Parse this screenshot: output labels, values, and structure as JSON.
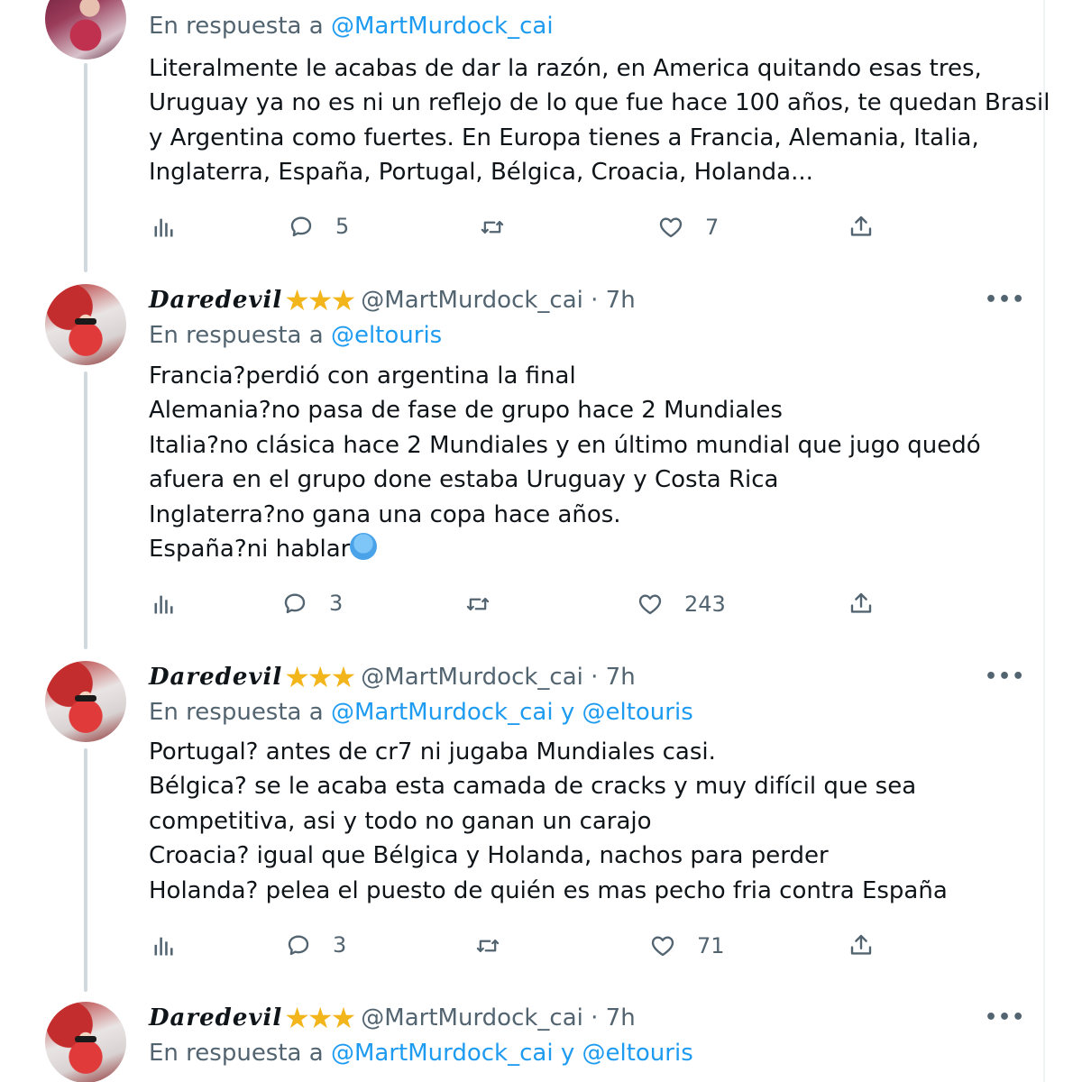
{
  "tweets": [
    {
      "reply_prefix": "En respuesta a ",
      "reply_mentions": "@MartMurdock_cai",
      "lines": [
        "Literalmente le acabas de dar la razón, en America quitando esas tres,",
        "Uruguay ya no es ni un reflejo de lo que fue hace 100 años, te quedan Brasil",
        "y Argentina como fuertes. En Europa tienes a Francia, Alemania, Italia,",
        "Inglaterra, España, Portugal, Bélgica, Croacia, Holanda..."
      ],
      "replies": "5",
      "retweets": "",
      "likes": "7"
    },
    {
      "display_name": "Daredevil",
      "stars": "★★★",
      "handle": "@MartMurdock_cai · 7h",
      "reply_prefix": "En respuesta a ",
      "reply_mentions": "@eltouris",
      "lines": [
        "Francia?perdió con argentina la final",
        "Alemania?no pasa de fase de grupo hace 2 Mundiales",
        "Italia?no clásica hace 2 Mundiales y en último mundial que jugo quedó",
        "afuera en el grupo done estaba Uruguay y Costa Rica",
        "Inglaterra?no gana una copa hace años.",
        "España?ni hablar"
      ],
      "emoji": "crying-face",
      "replies": "3",
      "retweets": "",
      "likes": "243"
    },
    {
      "display_name": "Daredevil",
      "stars": "★★★",
      "handle": "@MartMurdock_cai · 7h",
      "reply_prefix": "En respuesta a ",
      "reply_mentions": "@MartMurdock_cai y @eltouris",
      "lines": [
        "Portugal? antes de cr7 ni jugaba Mundiales casi.",
        "Bélgica? se le acaba esta camada de cracks y muy difícil que sea",
        "competitiva, asi y todo no ganan un carajo",
        "Croacia? igual que Bélgica y Holanda, nachos para perder",
        "Holanda? pelea el puesto de quién es mas pecho fria contra España"
      ],
      "replies": "3",
      "retweets": "",
      "likes": "71"
    },
    {
      "display_name": "Daredevil",
      "stars": "★★★",
      "handle": "@MartMurdock_cai · 7h",
      "reply_prefix": "En respuesta a ",
      "reply_mentions": "@MartMurdock_cai y @eltouris"
    }
  ],
  "icons": {
    "views": "bar-chart-icon",
    "reply": "speech-bubble-icon",
    "retweet": "retweet-icon",
    "like": "heart-icon",
    "share": "share-upload-icon",
    "more": "more-dots-icon"
  },
  "colors": {
    "link": "#1d9bf0",
    "secondary_text": "#536471",
    "stars": "#f2b51c"
  },
  "more_label": "•••"
}
